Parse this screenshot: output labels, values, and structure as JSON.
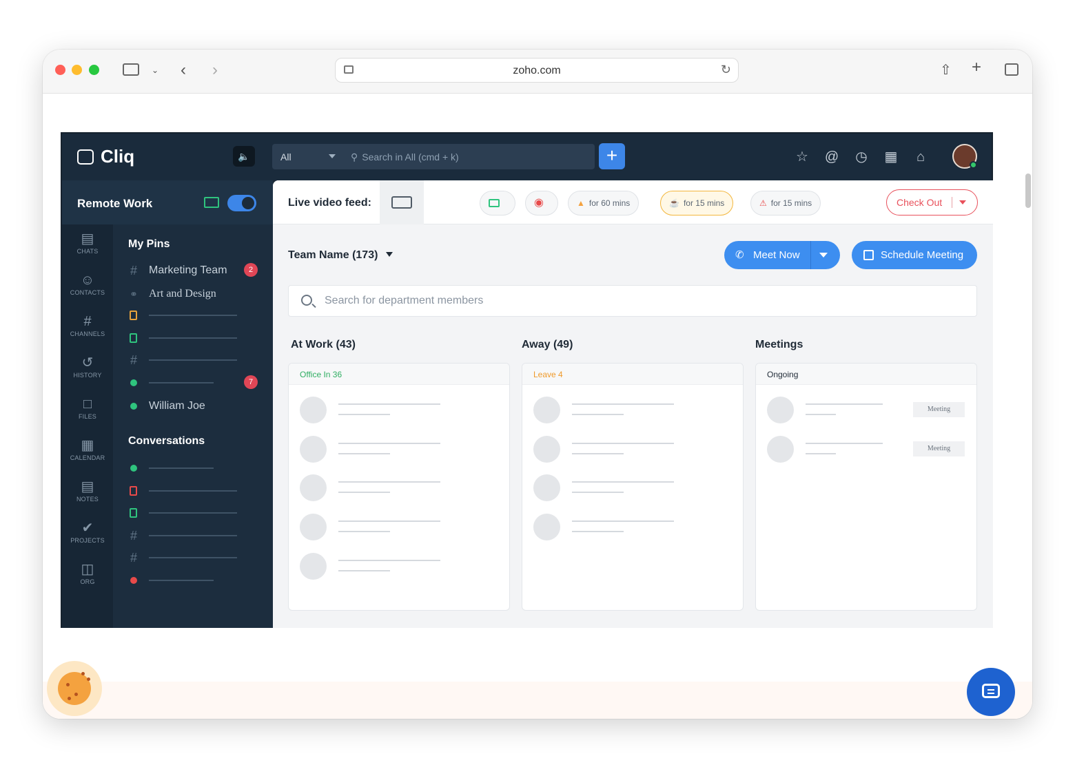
{
  "browser": {
    "url": "zoho.com",
    "icons": [
      "sidebar-icon",
      "chevron-down-icon",
      "back-icon",
      "forward-icon",
      "reader-icon",
      "reload-icon",
      "share-icon",
      "new-tab-icon",
      "tabs-overview-icon"
    ]
  },
  "app": {
    "name": "Cliq",
    "search_scope": "All",
    "search_placeholder": "Search in All (cmd + k)",
    "add_label": "+"
  },
  "workspace": {
    "name": "Remote Work"
  },
  "rail": [
    {
      "label": "CHATS",
      "icon": "chat-icon"
    },
    {
      "label": "CONTACTS",
      "icon": "person-icon"
    },
    {
      "label": "CHANNELS",
      "icon": "hash-icon"
    },
    {
      "label": "HISTORY",
      "icon": "history-icon"
    },
    {
      "label": "FILES",
      "icon": "file-icon"
    },
    {
      "label": "CALENDAR",
      "icon": "calendar-icon"
    },
    {
      "label": "NOTES",
      "icon": "notes-icon"
    },
    {
      "label": "PROJECTS",
      "icon": "check-icon"
    },
    {
      "label": "ORG",
      "icon": "org-icon"
    }
  ],
  "pins": {
    "title": "My Pins",
    "items": [
      {
        "label": "Marketing Team",
        "badge": "2"
      },
      {
        "label": "Art and Design"
      },
      {
        "label": "William Joe"
      }
    ],
    "unread_badge": "7"
  },
  "conversations": {
    "title": "Conversations"
  },
  "status": {
    "live_label": "Live video feed:",
    "pills": [
      {
        "label": "for 60 mins"
      },
      {
        "label": "for 15 mins"
      },
      {
        "label": "for 15 mins"
      }
    ],
    "checkout": "Check Out"
  },
  "team": {
    "name": "Team Name (173)",
    "meet_now": "Meet Now",
    "schedule": "Schedule Meeting",
    "search_placeholder": "Search for department members"
  },
  "columns": [
    {
      "title": "At Work (43)",
      "subheader": "Office In 36",
      "color": "#2fae62"
    },
    {
      "title": "Away (49)",
      "subheader": "Leave 4",
      "color": "#ef9a2a"
    },
    {
      "title": "Meetings",
      "subheader": "Ongoing",
      "color": "#1f2a36",
      "tag": "Meeting"
    }
  ],
  "colors": {
    "accent": "#3d8ef0",
    "dark": "#1c2b39",
    "danger": "#e8505b",
    "online": "#2fc47e"
  }
}
